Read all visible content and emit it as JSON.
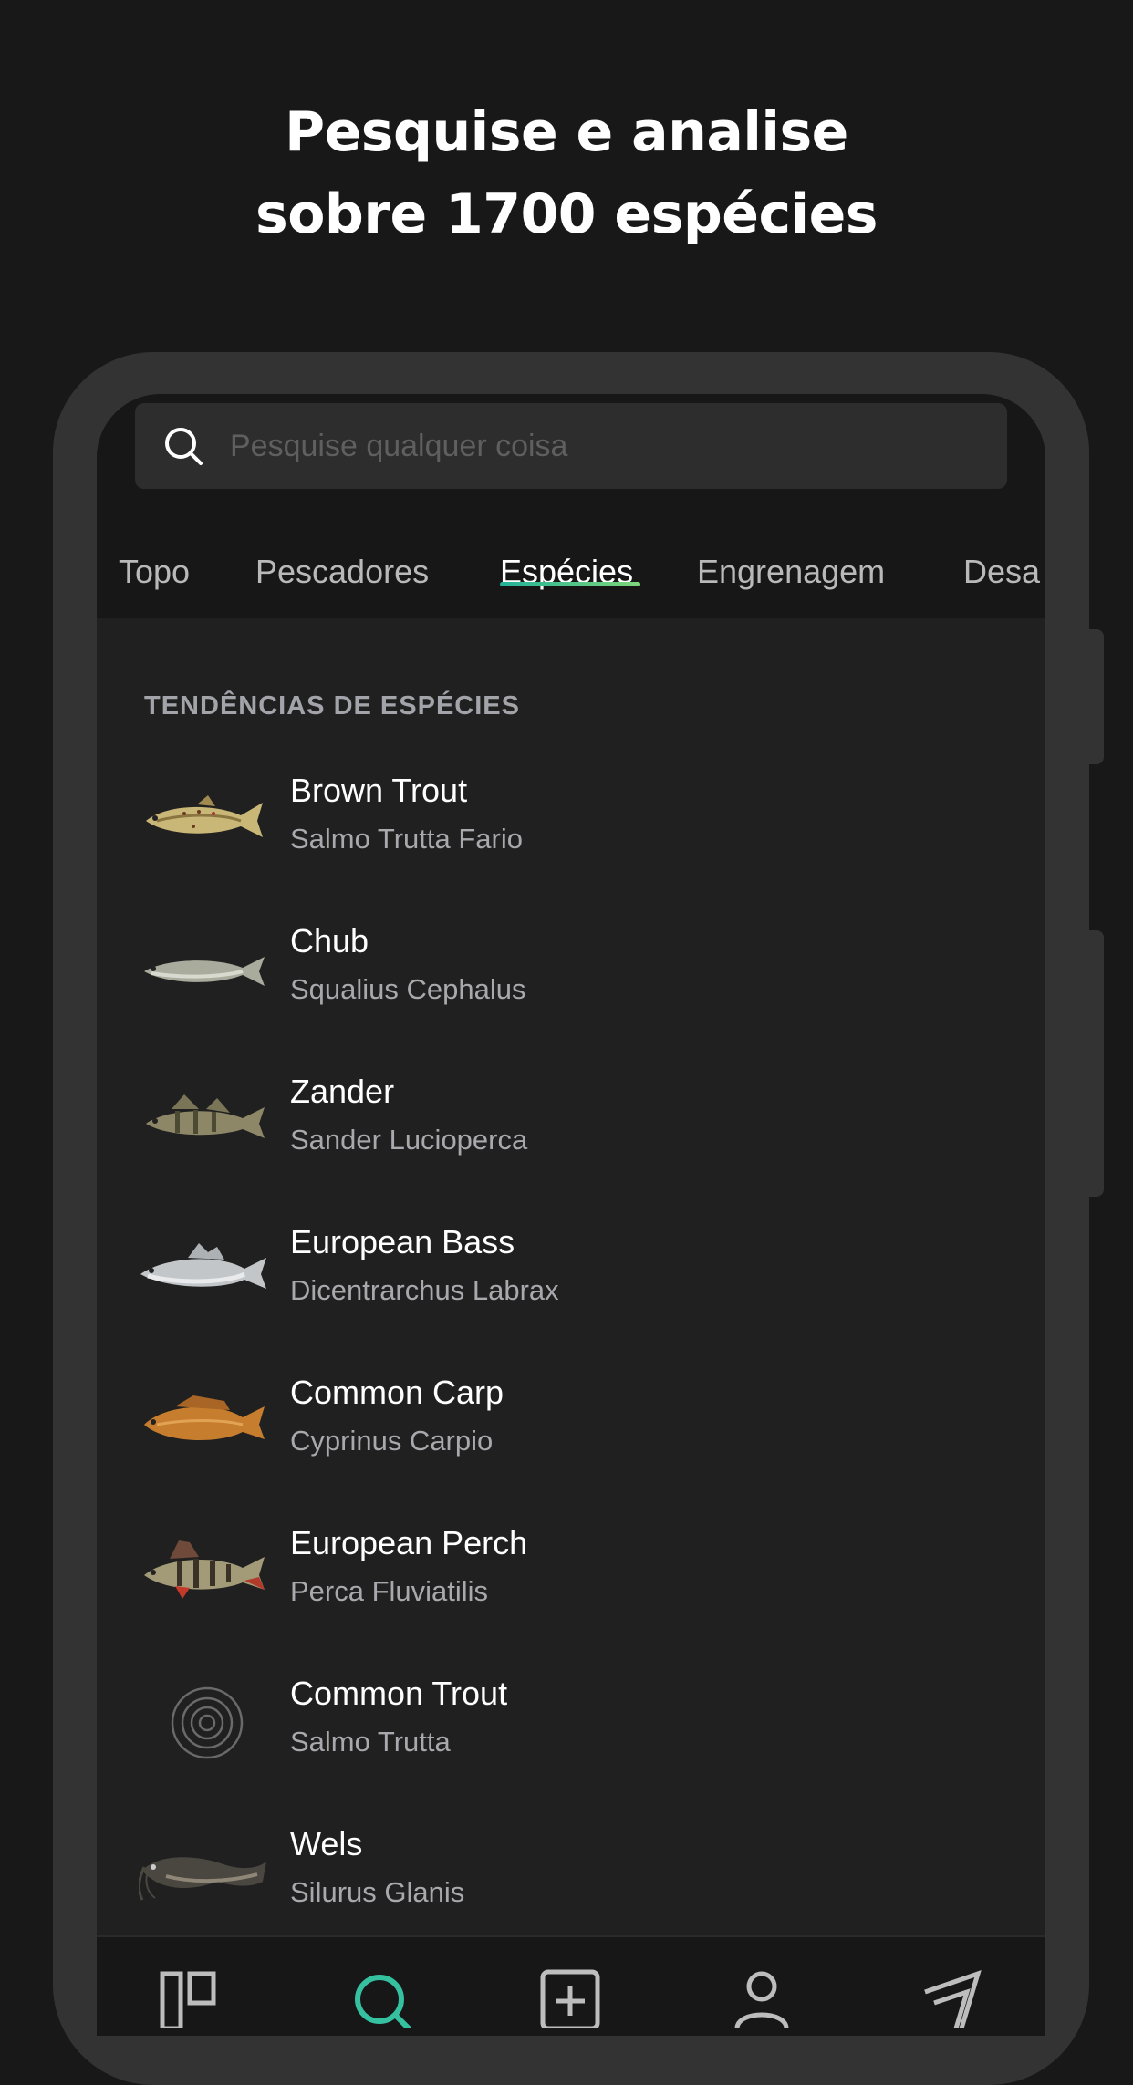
{
  "headline": {
    "line1": "Pesquise e analise",
    "line2": "sobre 1700 espécies"
  },
  "search": {
    "placeholder": "Pesquise qualquer coisa",
    "icon": "search-icon"
  },
  "tabs": [
    {
      "label": "Topo",
      "active": false
    },
    {
      "label": "Pescadores",
      "active": false
    },
    {
      "label": "Espécies",
      "active": true
    },
    {
      "label": "Engrenagem",
      "active": false
    },
    {
      "label": "Desa",
      "active": false
    }
  ],
  "section": {
    "title": "TENDÊNCIAS DE ESPÉCIES"
  },
  "species": [
    {
      "name": "Brown Trout",
      "scientific": "Salmo Trutta Fario",
      "icon": "brown-trout-image"
    },
    {
      "name": "Chub",
      "scientific": "Squalius Cephalus",
      "icon": "chub-image"
    },
    {
      "name": "Zander",
      "scientific": "Sander Lucioperca",
      "icon": "zander-image"
    },
    {
      "name": "European Bass",
      "scientific": "Dicentrarchus Labrax",
      "icon": "european-bass-image"
    },
    {
      "name": "Common Carp",
      "scientific": "Cyprinus Carpio",
      "icon": "common-carp-image"
    },
    {
      "name": "European Perch",
      "scientific": "Perca Fluviatilis",
      "icon": "european-perch-image"
    },
    {
      "name": "Common Trout",
      "scientific": "Salmo Trutta",
      "icon": "placeholder-rings-icon"
    },
    {
      "name": "Wels",
      "scientific": "Silurus Glanis",
      "icon": "wels-image"
    }
  ],
  "bottom_nav": [
    {
      "icon": "feed-icon",
      "active": false
    },
    {
      "icon": "search-icon",
      "active": true
    },
    {
      "icon": "add-catch-icon",
      "active": false
    },
    {
      "icon": "profile-icon",
      "active": false
    },
    {
      "icon": "map-icon",
      "active": false
    }
  ],
  "colors": {
    "background": "#181818",
    "phone_frame": "#333333",
    "screen": "#202020",
    "accent_start": "#22b39a",
    "accent_end": "#7ed67a"
  }
}
